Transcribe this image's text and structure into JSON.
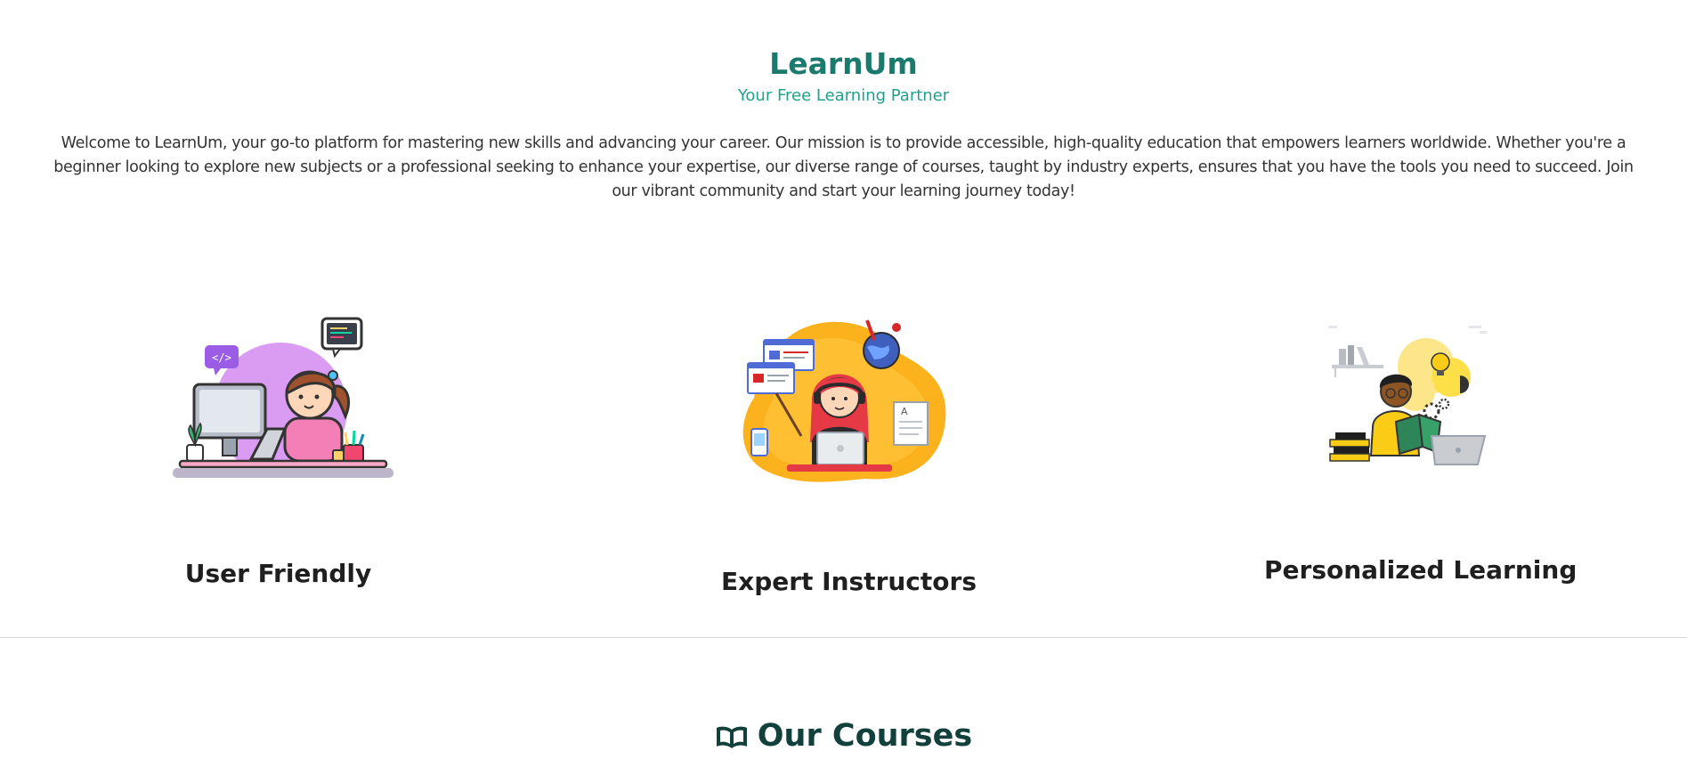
{
  "brand": {
    "title": "LearnUm",
    "tagline": "Your Free Learning Partner"
  },
  "intro": {
    "text": "Welcome to LearnUm, your go-to platform for mastering new skills and advancing your career. Our mission is to provide accessible, high-quality education that empowers learners worldwide. Whether you're a beginner looking to explore new subjects or a professional seeking to enhance your expertise, our diverse range of courses, taught by industry experts, ensures that you have the tools you need to succeed. Join our vibrant community and start your learning journey today!"
  },
  "features": [
    {
      "title": "User Friendly",
      "icon": "coding-girl-illustration"
    },
    {
      "title": "Expert Instructors",
      "icon": "instructor-headset-illustration"
    },
    {
      "title": "Personalized Learning",
      "icon": "reading-student-illustration"
    }
  ],
  "courses": {
    "heading": "Our Courses",
    "icon": "open-book-icon"
  },
  "colors": {
    "brand": "#1b7a6e",
    "tagline": "#21a08c",
    "heading_dark": "#12403b"
  }
}
